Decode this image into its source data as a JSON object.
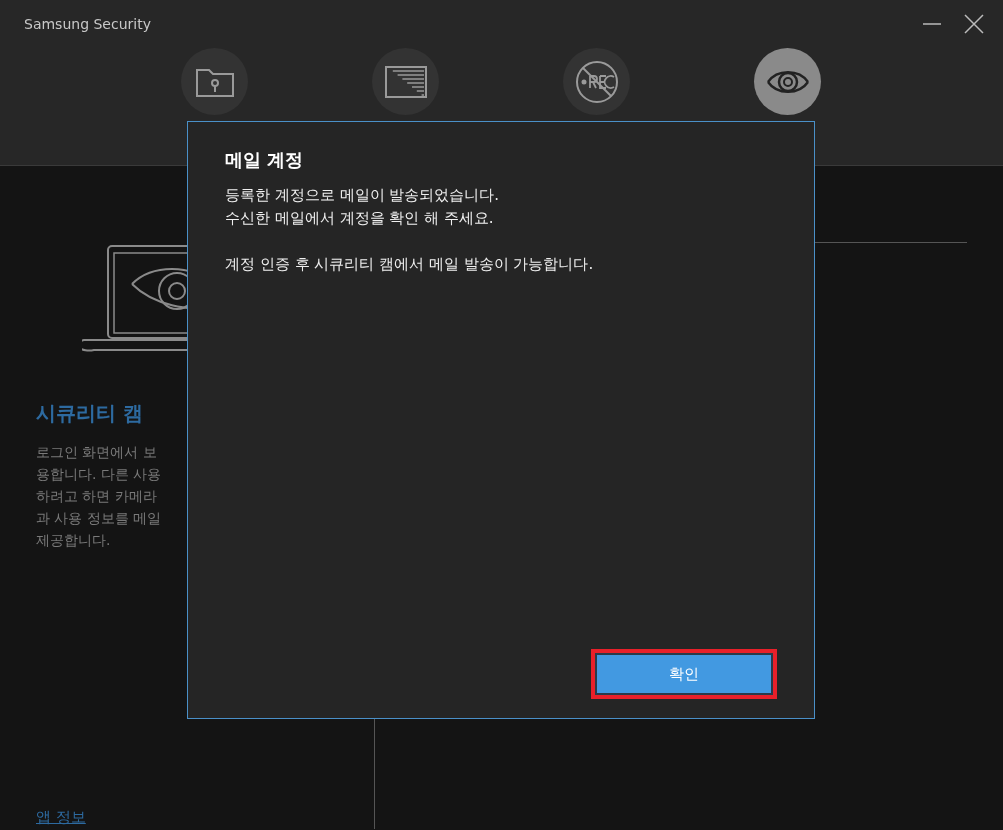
{
  "window": {
    "title": "Samsung Security"
  },
  "tabs": [
    {
      "kind": "folder",
      "selected": false
    },
    {
      "kind": "screen",
      "selected": false
    },
    {
      "kind": "no-rec",
      "selected": false
    },
    {
      "kind": "eye",
      "selected": true
    }
  ],
  "left_panel": {
    "title": "시큐리티 캠",
    "description_lines": [
      "로그인 화면에서 보",
      "용합니다. 다른 사용",
      "하려고 하면 카메라",
      "과 사용 정보를 메일",
      "제공합니다."
    ],
    "link": "앱 정보"
  },
  "dialog": {
    "title": "메일 계정",
    "paragraphs": [
      "등록한 계정으로 메일이 발송되었습니다.\n수신한 메일에서 계정을 확인 해 주세요.",
      "계정 인증 후 시큐리티 캠에서 메일 발송이 가능합니다."
    ],
    "button": {
      "label": "확인",
      "focused": true
    }
  }
}
